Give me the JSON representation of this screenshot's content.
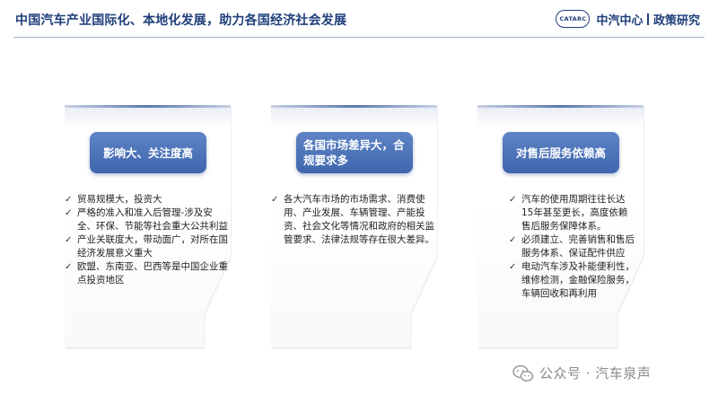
{
  "header": {
    "title": "中国汽车产业国际化、本地化发展，助力各国经济社会发展",
    "logo_text": "CATARC",
    "brand_name": "中汽中心",
    "brand_sub": "政策研究"
  },
  "cards": [
    {
      "heading": "影响大、关注度高",
      "bullets": [
        "贸易规模大，投资大",
        "严格的准入和准入后管理-涉及安全、环保、节能等社会重大公共利益",
        "产业关联度大，带动面广，对所在国经济发展意义重大",
        "欧盟、东南亚、巴西等是中国企业重点投资地区"
      ]
    },
    {
      "heading": "各国市场差异大，合规要求多",
      "bullets": [
        "各大汽车市场的市场需求、消费使用、产业发展、车辆管理、产能投资、社会文化等情况和政府的相关监管要求、法律法规等存在很大差异。"
      ]
    },
    {
      "heading": "对售后服务依赖高",
      "bullets": [
        "汽车的使用周期往往长达15年甚至更长，高度依赖售后服务保障体系。",
        "必须建立、完善销售和售后服务体系、保证配件供应",
        "电动汽车涉及补能便利性，维修检测，金融保险服务，车辆回收和再利用"
      ]
    }
  ],
  "check_mark": "✓",
  "watermark": {
    "icon": "wechat-icon",
    "text": "公众号 · 汽车泉声"
  },
  "colors": {
    "title": "#1f3f7a",
    "pill": "#4a6fb5",
    "rule": "#9fb0cc"
  }
}
